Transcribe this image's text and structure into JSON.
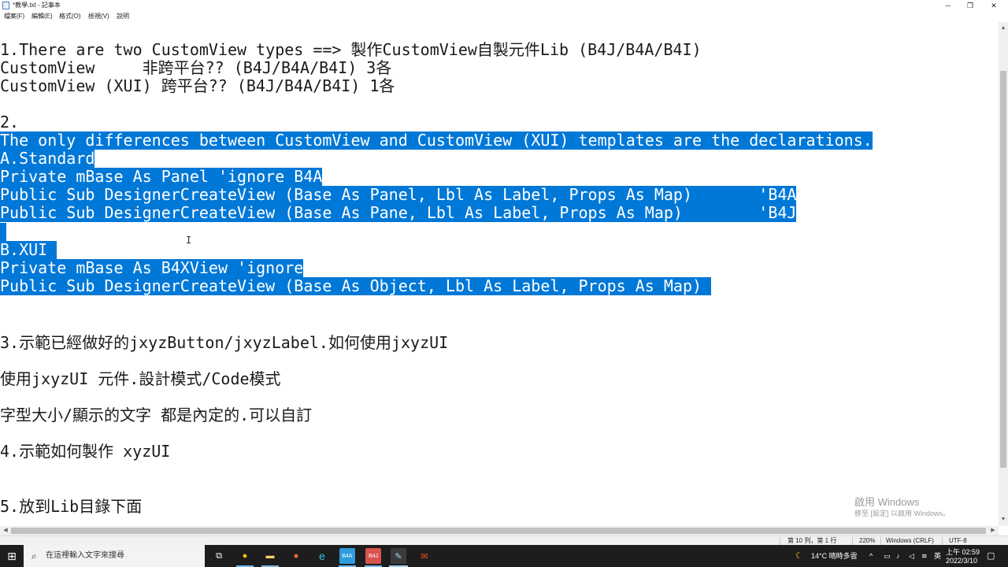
{
  "window": {
    "title": "*教學.txt - 記事本",
    "minimize": "─",
    "maximize": "❐",
    "close": "✕"
  },
  "menu": {
    "items": [
      "檔案(F)",
      "編輯(E)",
      "格式(O)",
      "檢視(V)",
      "說明"
    ]
  },
  "editor": {
    "lines": [
      "1.There are two CustomView types ==> 製作CustomView自製元件Lib (B4J/B4A/B4I)",
      "CustomView     非跨平台?? (B4J/B4A/B4I) 3各",
      "CustomView (XUI) 跨平台?? (B4J/B4A/B4I) 1各",
      "",
      "2.",
      "The only differences between CustomView and CustomView (XUI) templates are the declarations.",
      "A.Standard",
      "Private mBase As Panel 'ignore B4A",
      "Public Sub DesignerCreateView (Base As Panel, Lbl As Label, Props As Map)       'B4A",
      "Public Sub DesignerCreateView (Base As Pane, Lbl As Label, Props As Map)        'B4J",
      "",
      "B.XUI ",
      "Private mBase As B4XView 'ignore",
      "Public Sub DesignerCreateView (Base As Object, Lbl As Label, Props As Map) ",
      "",
      "",
      "3.示範已經做好的jxyzButton/jxyzLabel.如何使用jxyzUI",
      "",
      "使用jxyzUI 元件.設計模式/Code模式",
      "",
      "字型大小/顯示的文字 都是內定的.可以自訂",
      "",
      "4.示範如何製作 xyzUI",
      "",
      "",
      "5.放到Lib目錄下面"
    ],
    "selected_lines": [
      5,
      6,
      7,
      8,
      9,
      11,
      12,
      13
    ],
    "selection_color": "#0078d7",
    "cursor": "I"
  },
  "scrollbar": {
    "up": "▲",
    "down": "▼",
    "left": "◀",
    "right": "▶"
  },
  "status": {
    "position": "第 10 列，第 1 行",
    "zoom": "220%",
    "line_ending": "Windows (CRLF)",
    "encoding": "UTF-8"
  },
  "watermark": {
    "line1": "啟用 Windows",
    "line2": "移至 [設定] 以啟用 Windows。"
  },
  "taskbar": {
    "search_placeholder": "在這裡輸入文字來搜尋",
    "apps": [
      {
        "icon": "windows-start-icon",
        "glyph": "⊞"
      },
      {
        "icon": "task-view-icon",
        "glyph": "⧉"
      },
      {
        "icon": "chrome-icon",
        "glyph": "●"
      },
      {
        "icon": "file-explorer-icon",
        "glyph": "▬"
      },
      {
        "icon": "firefox-icon",
        "glyph": "●"
      },
      {
        "icon": "edge-icon",
        "glyph": "e"
      },
      {
        "icon": "b4a-icon",
        "glyph": "B4A"
      },
      {
        "icon": "b4j-icon",
        "glyph": "B4J"
      },
      {
        "icon": "notepad-icon",
        "glyph": "✎"
      },
      {
        "icon": "app-icon",
        "glyph": "✉"
      }
    ],
    "weather": "14°C  晴時多雲",
    "ime": "英",
    "time": "上午 02:59",
    "date": "2022/3/10"
  }
}
